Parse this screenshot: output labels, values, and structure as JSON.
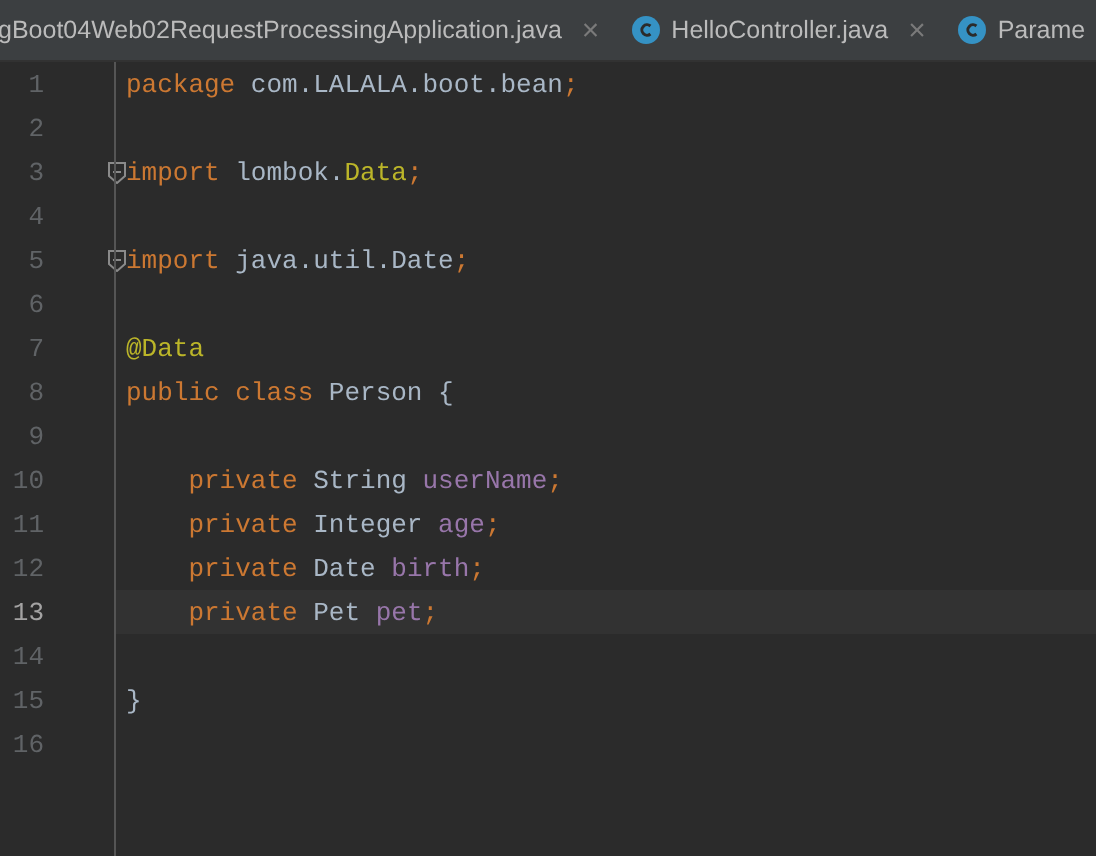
{
  "tabs": [
    {
      "label": "gBoot04Web02RequestProcessingApplication.java",
      "icon": false,
      "close": "×"
    },
    {
      "label": "HelloController.java",
      "icon": true,
      "close": "×"
    },
    {
      "label": "Parame",
      "icon": true
    }
  ],
  "lines": [
    {
      "number": "1",
      "current": false,
      "fold": false,
      "tokens": [
        {
          "text": "package ",
          "kind": "keyword"
        },
        {
          "text": "com.LALALA.boot.bean",
          "kind": "plain"
        },
        {
          "text": ";",
          "kind": "keyword"
        }
      ]
    },
    {
      "number": "2",
      "current": false,
      "fold": false
    },
    {
      "number": "3",
      "current": false,
      "fold": true,
      "tokens": [
        {
          "text": "import ",
          "kind": "keyword"
        },
        {
          "text": "lombok.",
          "kind": "plain"
        },
        {
          "text": "Data",
          "kind": "annotation"
        },
        {
          "text": ";",
          "kind": "keyword"
        }
      ]
    },
    {
      "number": "4",
      "current": false,
      "fold": false
    },
    {
      "number": "5",
      "current": false,
      "fold": true,
      "tokens": [
        {
          "text": "import ",
          "kind": "keyword"
        },
        {
          "text": "java.util.Date",
          "kind": "plain"
        },
        {
          "text": ";",
          "kind": "keyword"
        }
      ]
    },
    {
      "number": "6",
      "current": false,
      "fold": false
    },
    {
      "number": "7",
      "current": false,
      "fold": false,
      "tokens": [
        {
          "text": "@Data",
          "kind": "annotation"
        }
      ]
    },
    {
      "number": "8",
      "current": false,
      "fold": false,
      "tokens": [
        {
          "text": "public class ",
          "kind": "keyword"
        },
        {
          "text": "Person {",
          "kind": "plain"
        }
      ]
    },
    {
      "number": "9",
      "current": false,
      "fold": false
    },
    {
      "number": "10",
      "current": false,
      "fold": false,
      "tokens": [
        {
          "text": "    private ",
          "kind": "keyword"
        },
        {
          "text": "String ",
          "kind": "plain"
        },
        {
          "text": "userName",
          "kind": "field"
        },
        {
          "text": ";",
          "kind": "keyword"
        }
      ]
    },
    {
      "number": "11",
      "current": false,
      "fold": false,
      "tokens": [
        {
          "text": "    private ",
          "kind": "keyword"
        },
        {
          "text": "Integer ",
          "kind": "plain"
        },
        {
          "text": "age",
          "kind": "field"
        },
        {
          "text": ";",
          "kind": "keyword"
        }
      ]
    },
    {
      "number": "12",
      "current": false,
      "fold": false,
      "tokens": [
        {
          "text": "    private ",
          "kind": "keyword"
        },
        {
          "text": "Date ",
          "kind": "plain"
        },
        {
          "text": "birth",
          "kind": "field"
        },
        {
          "text": ";",
          "kind": "keyword"
        }
      ]
    },
    {
      "number": "13",
      "current": true,
      "fold": false,
      "tokens": [
        {
          "text": "    private ",
          "kind": "keyword"
        },
        {
          "text": "Pet ",
          "kind": "plain"
        },
        {
          "text": "pet",
          "kind": "field"
        },
        {
          "text": ";",
          "kind": "keyword"
        }
      ]
    },
    {
      "number": "14",
      "current": false,
      "fold": false
    },
    {
      "number": "15",
      "current": false,
      "fold": false,
      "tokens": [
        {
          "text": "}",
          "kind": "plain"
        }
      ]
    },
    {
      "number": "16",
      "current": false,
      "fold": false
    }
  ]
}
